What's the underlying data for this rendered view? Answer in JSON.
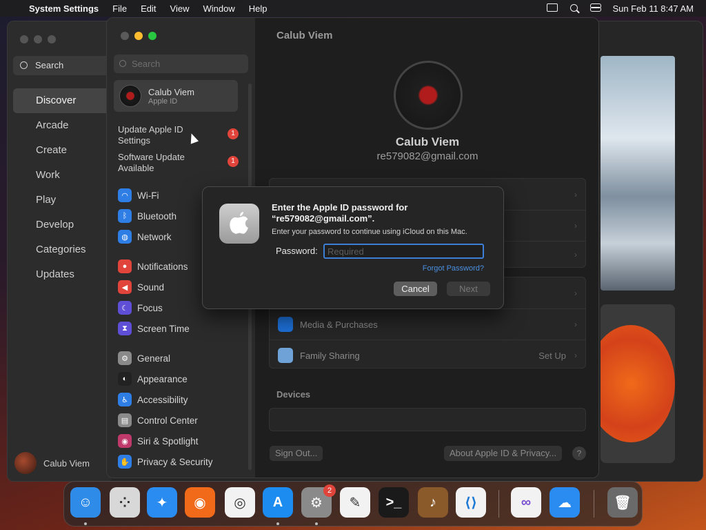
{
  "menubar": {
    "app_name": "System Settings",
    "menus": [
      "File",
      "Edit",
      "View",
      "Window",
      "Help"
    ],
    "datetime": "Sun Feb 11  8:47 AM"
  },
  "appstore": {
    "search_label": "Search",
    "nav": [
      "Discover",
      "Arcade",
      "Create",
      "Work",
      "Play",
      "Develop",
      "Categories",
      "Updates"
    ],
    "active_nav": "Discover",
    "user_name": "Calub Viem"
  },
  "settings": {
    "search_placeholder": "Search",
    "account": {
      "name": "Calub Viem",
      "sub": "Apple ID"
    },
    "alerts": [
      {
        "label": "Update Apple ID Settings",
        "badge": "1"
      },
      {
        "label": "Software Update Available",
        "badge": "1"
      }
    ],
    "sidebar_items": [
      {
        "label": "Wi-Fi",
        "icon": "wifi-icon",
        "color": "#2f7ee6"
      },
      {
        "label": "Bluetooth",
        "icon": "bluetooth-icon",
        "color": "#2f7ee6"
      },
      {
        "label": "Network",
        "icon": "globe-icon",
        "color": "#2f7ee6"
      },
      {
        "label": "Notifications",
        "icon": "bell-icon",
        "color": "#e0443a"
      },
      {
        "label": "Sound",
        "icon": "speaker-icon",
        "color": "#e0443a"
      },
      {
        "label": "Focus",
        "icon": "moon-icon",
        "color": "#5e4fd6"
      },
      {
        "label": "Screen Time",
        "icon": "hourglass-icon",
        "color": "#5e4fd6"
      },
      {
        "label": "General",
        "icon": "gear-icon",
        "color": "#8a8a8a"
      },
      {
        "label": "Appearance",
        "icon": "appearance-icon",
        "color": "#222"
      },
      {
        "label": "Accessibility",
        "icon": "accessibility-icon",
        "color": "#2f7ee6"
      },
      {
        "label": "Control Center",
        "icon": "control-center-icon",
        "color": "#8a8a8a"
      },
      {
        "label": "Siri & Spotlight",
        "icon": "siri-icon",
        "color": "#c0396b"
      },
      {
        "label": "Privacy & Security",
        "icon": "hand-icon",
        "color": "#2f7ee6"
      }
    ],
    "main": {
      "title": "Calub Viem",
      "user_name": "Calub Viem",
      "email": "re579082@gmail.com",
      "rows": [
        {
          "label": "Media & Purchases",
          "value": ""
        },
        {
          "label": "Family Sharing",
          "value": "Set Up"
        }
      ],
      "devices_header": "Devices",
      "sign_out": "Sign Out...",
      "about": "About Apple ID & Privacy...",
      "help": "?"
    }
  },
  "dialog": {
    "title": "Enter the Apple ID password for “re579082@gmail.com”.",
    "message": "Enter your password to continue using iCloud on this Mac.",
    "password_label": "Password:",
    "password_placeholder": "Required",
    "forgot": "Forgot Password?",
    "cancel": "Cancel",
    "next": "Next"
  },
  "dock": {
    "apps": [
      {
        "name": "Finder",
        "icon": "finder-icon",
        "color": "#2f8be8",
        "running": true
      },
      {
        "name": "Launchpad",
        "icon": "launchpad-icon",
        "color": "#d8d8d8",
        "running": false
      },
      {
        "name": "Safari",
        "icon": "safari-icon",
        "color": "#2a8cf0",
        "running": false
      },
      {
        "name": "Firefox",
        "icon": "firefox-icon",
        "color": "#f06a1a",
        "running": false
      },
      {
        "name": "Chrome",
        "icon": "chrome-icon",
        "color": "#f2f2f2",
        "running": false
      },
      {
        "name": "App Store",
        "icon": "app-store-icon",
        "color": "#1d8cf0",
        "running": true
      },
      {
        "name": "System Settings",
        "icon": "settings-gear-icon",
        "color": "#8a8a8a",
        "running": true,
        "badge": "2"
      },
      {
        "name": "TextEdit",
        "icon": "textedit-icon",
        "color": "#f2f2f2",
        "running": false
      },
      {
        "name": "Terminal",
        "icon": "terminal-icon",
        "color": "#1a1a1a",
        "running": false
      },
      {
        "name": "GarageBand",
        "icon": "guitar-icon",
        "color": "#8a5a2a",
        "running": false
      },
      {
        "name": "VS Code",
        "icon": "vscode-icon",
        "color": "#f2f2f2",
        "running": false
      },
      {
        "name": "Visual Studio",
        "icon": "visual-studio-icon",
        "color": "#f2f2f2",
        "running": false
      },
      {
        "name": "Weather",
        "icon": "weather-icon",
        "color": "#2a8cf0",
        "running": false
      },
      {
        "name": "Trash",
        "icon": "trash-icon",
        "color": "#6a6a6a",
        "running": false
      }
    ]
  }
}
